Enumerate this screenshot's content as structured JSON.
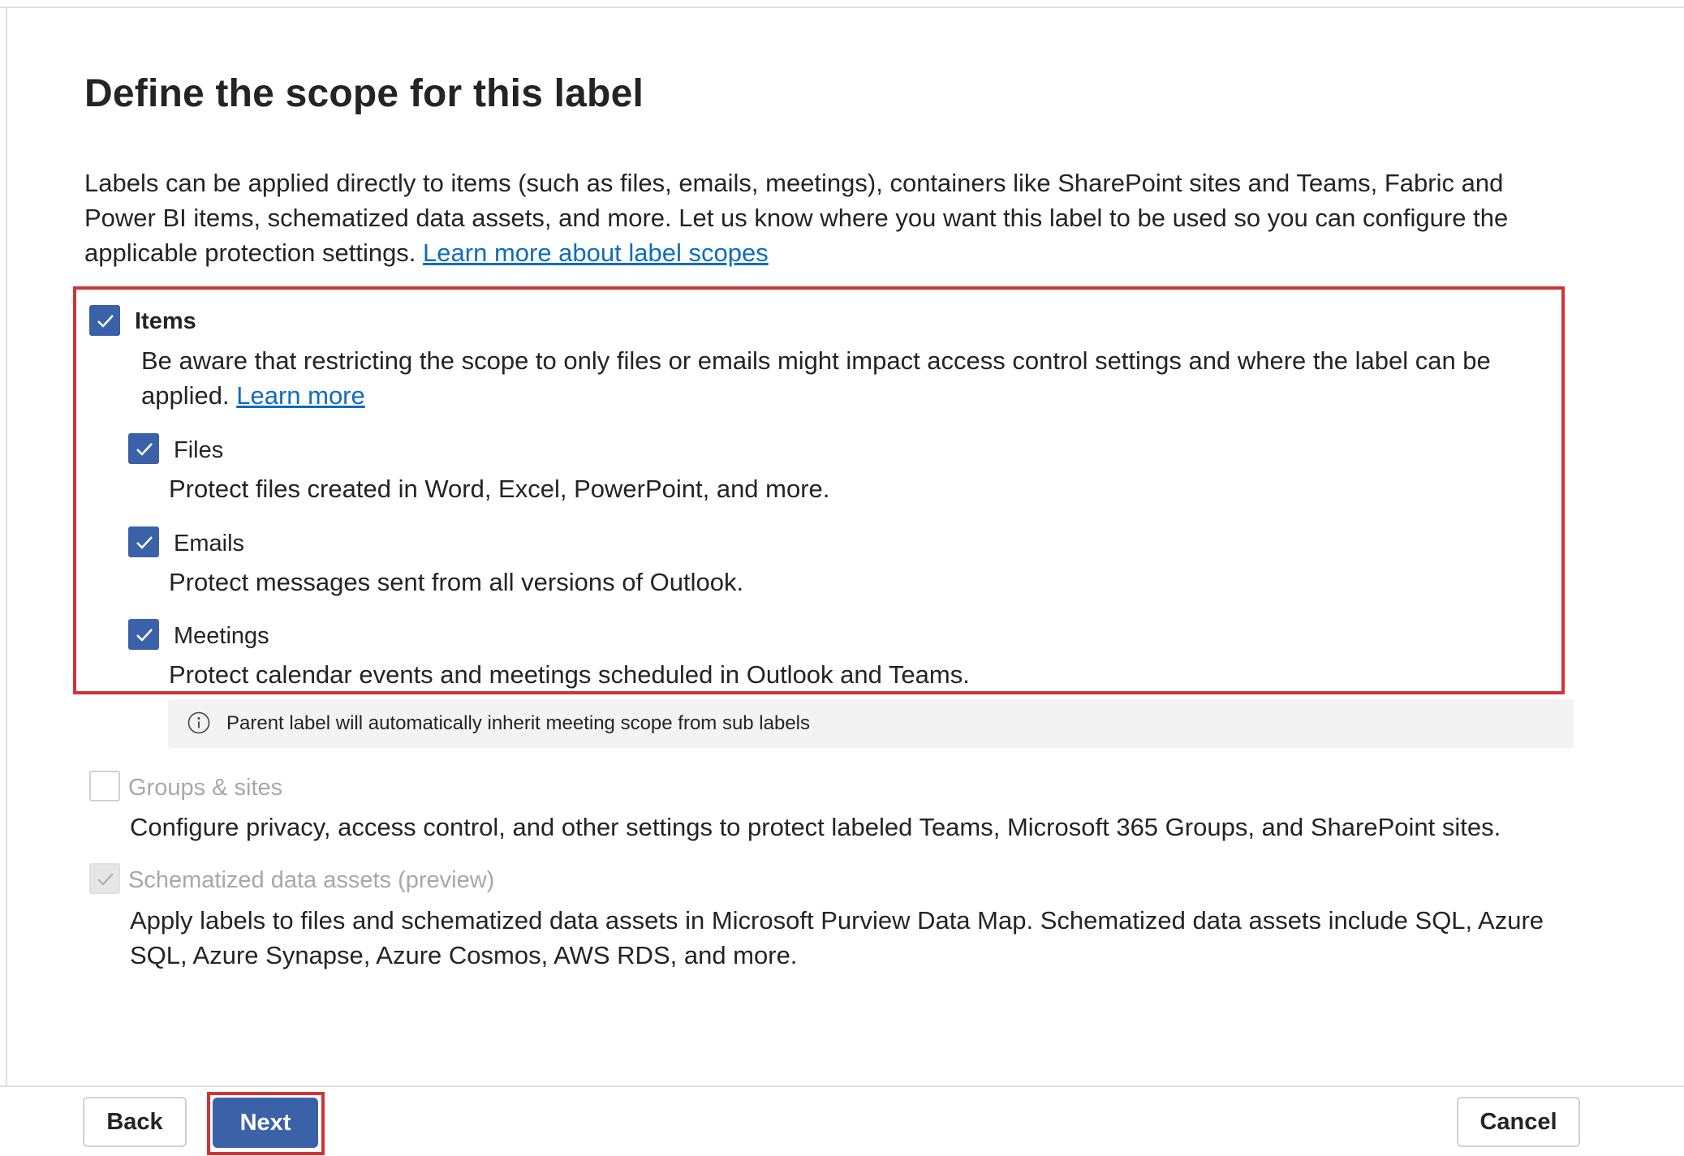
{
  "page": {
    "title": "Define the scope for this label",
    "intro": "Labels can be applied directly to items (such as files, emails, meetings), containers like SharePoint sites and Teams, Fabric and Power BI items, schematized data assets, and more. Let us know where you want this label to be used so you can configure the applicable protection settings.",
    "intro_link": "Learn more about label scopes"
  },
  "scopes": {
    "items": {
      "label": "Items",
      "checked": true,
      "description": "Be aware that restricting the scope to only files or emails might impact access control settings and where the label can be applied.",
      "link": "Learn more",
      "sub": [
        {
          "label": "Files",
          "checked": true,
          "description": "Protect files created in Word, Excel, PowerPoint, and more."
        },
        {
          "label": "Emails",
          "checked": true,
          "description": "Protect messages sent from all versions of Outlook."
        },
        {
          "label": "Meetings",
          "checked": true,
          "description": "Protect calendar events and meetings scheduled in Outlook and Teams."
        }
      ],
      "info": "Parent label will automatically inherit meeting scope from sub labels"
    },
    "groups": {
      "label": "Groups & sites",
      "checked": false,
      "disabled": true,
      "description": "Configure privacy, access control, and other settings to protect labeled Teams, Microsoft 365 Groups, and SharePoint sites."
    },
    "schematized": {
      "label": "Schematized data assets (preview)",
      "checked": true,
      "disabled": true,
      "description": "Apply labels to files and schematized data assets in Microsoft Purview Data Map. Schematized data assets include SQL, Azure SQL, Azure Synapse, Azure Cosmos, AWS RDS, and more."
    }
  },
  "footer": {
    "back": "Back",
    "next": "Next",
    "cancel": "Cancel"
  },
  "colors": {
    "accent": "#3b62a8",
    "highlight": "#d13438",
    "link": "#0f6cbd"
  }
}
